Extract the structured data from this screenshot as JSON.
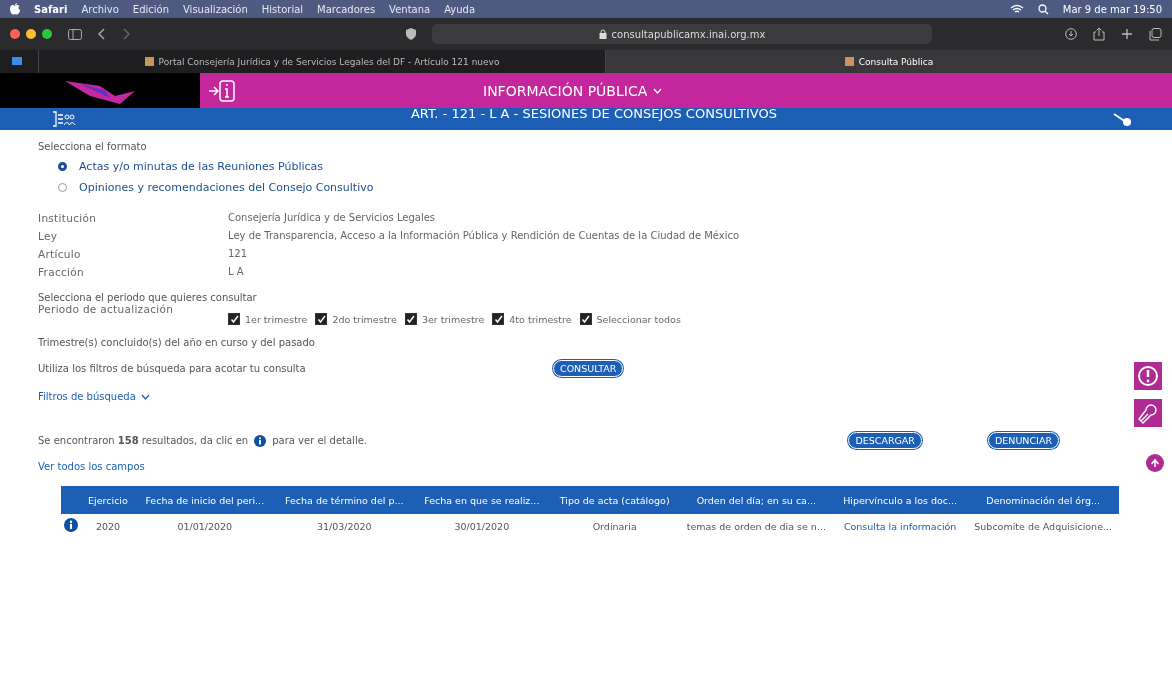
{
  "menubar": {
    "app": "Safari",
    "items": [
      "Archivo",
      "Edición",
      "Visualización",
      "Historial",
      "Marcadores",
      "Ventana",
      "Ayuda"
    ],
    "clock": "Mar 9 de mar  19:50"
  },
  "browser": {
    "url": "consultapublicamx.inai.org.mx",
    "tabs": [
      {
        "title": "Portal Consejería Jurídica y de Servicios Legales del DF - Artículo 121 nuevo",
        "selected": false
      },
      {
        "title": "Consulta Pública",
        "selected": true
      }
    ]
  },
  "header": {
    "title": "INFORMACIÓN PÚBLICA"
  },
  "banner": {
    "title": "ART. - 121 - L A - SESIONES DE CONSEJOS CONSULTIVOS"
  },
  "format": {
    "label": "Selecciona el formato",
    "options": [
      {
        "label": "Actas y/o minutas de las Reuniones Públicas",
        "selected": true
      },
      {
        "label": "Opiniones y recomendaciones del Consejo Consultivo",
        "selected": false
      }
    ]
  },
  "info": [
    {
      "label": "Institución",
      "value": "Consejería Jurídica y de Servicios Legales"
    },
    {
      "label": "Ley",
      "value": "Ley de Transparencia, Acceso a la Información Pública y Rendición de Cuentas de la Ciudad de México"
    },
    {
      "label": "Artículo",
      "value": "121"
    },
    {
      "label": "Fracción",
      "value": "L A"
    }
  ],
  "period": {
    "prompt": "Selecciona el periodo que quieres consultar",
    "label": "Periodo de actualización",
    "options": [
      {
        "label": "1er trimestre",
        "checked": true
      },
      {
        "label": "2do trimestre",
        "checked": true
      },
      {
        "label": "3er trimestre",
        "checked": true
      },
      {
        "label": "4to trimestre",
        "checked": true
      },
      {
        "label": "Seleccionar todos",
        "checked": true
      }
    ],
    "note": "Trimestre(s) concluido(s) del año en curso y del pasado"
  },
  "filters": {
    "hint": "Utiliza los filtros de búsqueda para acotar tu consulta",
    "button": "CONSULTAR",
    "toggle": "Filtros de búsqueda"
  },
  "results": {
    "text_before": "Se encontraron **158** resultados, da clic en",
    "text_after": "para ver el detalle.",
    "download": "DESCARGAR",
    "report": "DENUNCIAR",
    "show_all": "Ver todos los campos"
  },
  "table": {
    "columns": [
      "Ejercicio",
      "Fecha de inicio del peri...",
      "Fecha de término del p...",
      "Fecha en que se realiz...",
      "Tipo de acta (catálogo)",
      "Orden del día; en su ca...",
      "Hipervínculo a los doc...",
      "Denominación del órg..."
    ],
    "rows": [
      {
        "cells": [
          "2020",
          "01/01/2020",
          "31/03/2020",
          "30/01/2020",
          "Ordinaria",
          "temas de orden de dia se n...",
          "Consulta la información",
          "Subcomite de Adquisicione..."
        ]
      }
    ]
  }
}
